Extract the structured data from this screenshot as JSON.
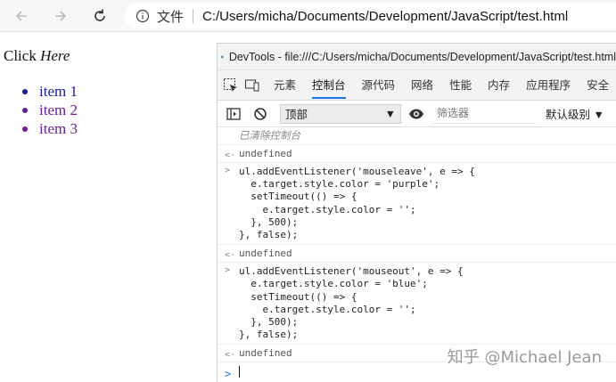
{
  "browser": {
    "scheme_label": "文件",
    "url": "C:/Users/micha/Documents/Development/JavaScript/test.html"
  },
  "page": {
    "click_prefix": "Click",
    "click_here": "Here",
    "items": [
      {
        "label": "item 1",
        "color": "#1a1aa6"
      },
      {
        "label": "item 2",
        "color": "#6a1b9a"
      },
      {
        "label": "item 3",
        "color": "#6a1b9a"
      }
    ]
  },
  "devtools": {
    "title": "DevTools - file:///C:/Users/micha/Documents/Development/JavaScript/test.html",
    "tabs": [
      "元素",
      "控制台",
      "源代码",
      "网络",
      "性能",
      "内存",
      "应用程序",
      "安全"
    ],
    "active_tab": "控制台",
    "context": "顶部",
    "filter_placeholder": "筛选器",
    "levels": "默认级别 ▼",
    "console": {
      "cleared": "已清除控制台",
      "undefined": "undefined",
      "block1": [
        "ul.addEventListener('mouseleave', e => {",
        "  e.target.style.color = 'purple';",
        "  setTimeout(() => {",
        "    e.target.style.color = '';",
        "  }, 500);",
        "}, false);"
      ],
      "block2": [
        "ul.addEventListener('mouseout', e => {",
        "  e.target.style.color = 'blue';",
        "  setTimeout(() => {",
        "    e.target.style.color = '';",
        "  }, 500);",
        "}, false);"
      ]
    }
  },
  "watermark": "知乎 @Michael Jean"
}
